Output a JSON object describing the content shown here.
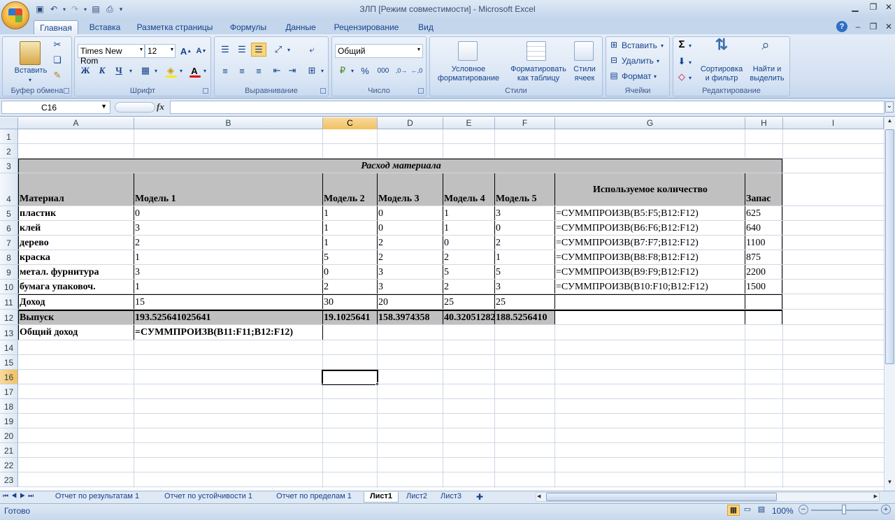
{
  "window": {
    "title": "ЗЛП  [Режим совместимости] - Microsoft Excel"
  },
  "ribbon_tabs": [
    "Главная",
    "Вставка",
    "Разметка страницы",
    "Формулы",
    "Данные",
    "Рецензирование",
    "Вид"
  ],
  "clipboard": {
    "paste": "Вставить",
    "label": "Буфер обмена"
  },
  "font": {
    "name": "Times New Rom",
    "size": "12",
    "label": "Шрифт",
    "bold": "Ж",
    "italic": "К",
    "underline": "Ч"
  },
  "alignment": {
    "label": "Выравнивание"
  },
  "number": {
    "format": "Общий",
    "label": "Число",
    "percent": "%",
    "thousands": "000"
  },
  "styles": {
    "cond1": "Условное",
    "cond2": "форматирование",
    "table1": "Форматировать",
    "table2": "как таблицу",
    "cell1": "Стили",
    "cell2": "ячеек",
    "label": "Стили"
  },
  "cells_group": {
    "insert": "Вставить",
    "delete": "Удалить",
    "format": "Формат",
    "label": "Ячейки"
  },
  "editing": {
    "sigma": "Σ",
    "sort1": "Сортировка",
    "sort2": "и фильтр",
    "find1": "Найти и",
    "find2": "выделить",
    "label": "Редактирование"
  },
  "formula_bar": {
    "name_box": "C16",
    "fx": "fx",
    "formula": ""
  },
  "columns": [
    "A",
    "B",
    "C",
    "D",
    "E",
    "F",
    "G",
    "H",
    "I"
  ],
  "rows": [
    "1",
    "2",
    "3",
    "4",
    "5",
    "6",
    "7",
    "8",
    "9",
    "10",
    "11",
    "12",
    "13",
    "14",
    "15",
    "16",
    "17",
    "18",
    "19",
    "20",
    "21",
    "22",
    "23"
  ],
  "sheet": {
    "title": "Расход материала",
    "headers": [
      "Материал",
      "Модель 1",
      "Модель 2",
      "Модель 3",
      "Модель 4",
      "Модель 5",
      "Используемое количество",
      "Запас"
    ],
    "materials": [
      {
        "name": "пластик",
        "m": [
          "0",
          "1",
          "0",
          "1",
          "3"
        ],
        "formula": "=СУММПРОИЗВ(B5:F5;B12:F12)",
        "stock": "625"
      },
      {
        "name": "клей",
        "m": [
          "3",
          "1",
          "0",
          "1",
          "0"
        ],
        "formula": "=СУММПРОИЗВ(B6:F6;B12:F12)",
        "stock": "640"
      },
      {
        "name": "дерево",
        "m": [
          "2",
          "1",
          "2",
          "0",
          "2"
        ],
        "formula": "=СУММПРОИЗВ(B7:F7;B12:F12)",
        "stock": "1100"
      },
      {
        "name": "краска",
        "m": [
          "1",
          "5",
          "2",
          "2",
          "1"
        ],
        "formula": "=СУММПРОИЗВ(B8:F8;B12:F12)",
        "stock": "875"
      },
      {
        "name": "метал. фурнитура",
        "m": [
          "3",
          "0",
          "3",
          "5",
          "5"
        ],
        "formula": "=СУММПРОИЗВ(B9:F9;B12:F12)",
        "stock": "2200"
      },
      {
        "name": "бумага упаковоч.",
        "m": [
          "1",
          "2",
          "3",
          "2",
          "3"
        ],
        "formula": "=СУММПРОИЗВ(B10:F10;B12:F12)",
        "stock": "1500"
      }
    ],
    "income": {
      "label": "Доход",
      "values": [
        "15",
        "30",
        "20",
        "25",
        "25"
      ]
    },
    "output": {
      "label": "Выпуск",
      "values": [
        "193.525641025641",
        "19.1025641",
        "158.3974358",
        "40.32051282",
        "188.5256410"
      ]
    },
    "total": {
      "label": "Общий доход",
      "formula": "=СУММПРОИЗВ(B11:F11;B12:F12)"
    }
  },
  "sheet_tabs": [
    "Отчет по результатам 1",
    "Отчет по устойчивости 1",
    "Отчет по пределам 1",
    "Лист1",
    "Лист2",
    "Лист3"
  ],
  "active_sheet": "Лист1",
  "status": {
    "ready": "Готово",
    "zoom": "100%"
  }
}
